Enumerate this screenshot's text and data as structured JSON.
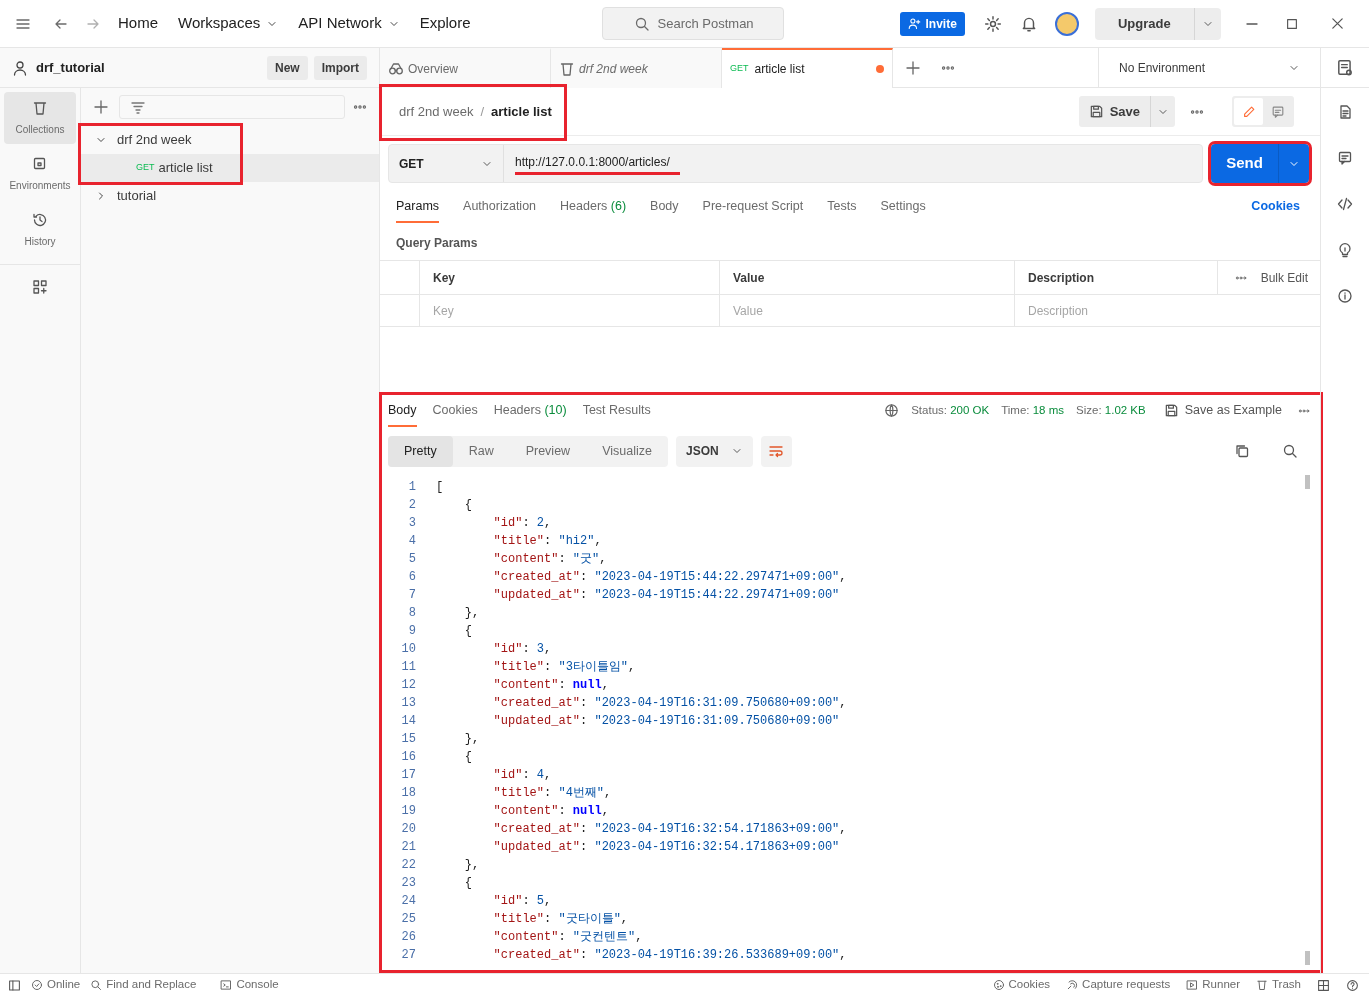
{
  "title_bar": {
    "nav": [
      {
        "label": "Home",
        "dropdown": false
      },
      {
        "label": "Workspaces",
        "dropdown": true
      },
      {
        "label": "API Network",
        "dropdown": true
      },
      {
        "label": "Explore",
        "dropdown": false
      }
    ],
    "search": {
      "placeholder": "Search Postman"
    },
    "invite": "Invite",
    "upgrade": "Upgrade"
  },
  "workspace": {
    "name": "drf_tutorial",
    "buttons": [
      "New",
      "Import"
    ]
  },
  "sidebar": {
    "items": [
      {
        "label": "Collections",
        "kind": "collections",
        "selected": true
      },
      {
        "label": "Environments",
        "kind": "environments",
        "selected": false
      },
      {
        "label": "History",
        "kind": "history",
        "selected": false
      }
    ]
  },
  "collections": [
    {
      "name": "drf 2nd week",
      "expanded": true,
      "children": [
        {
          "method": "GET",
          "name": "article list",
          "selected": true
        }
      ]
    },
    {
      "name": "tutorial",
      "expanded": false
    }
  ],
  "tabs": [
    {
      "kind": "overview",
      "label": "Overview",
      "selected": false,
      "unsaved": false
    },
    {
      "kind": "collection",
      "label": "drf 2nd week",
      "selected": false,
      "unsaved": false
    },
    {
      "kind": "request",
      "method": "GET",
      "label": "article list",
      "selected": true,
      "unsaved": true
    }
  ],
  "environment": "No Environment",
  "breadcrumb": [
    "drf 2nd week",
    "article list"
  ],
  "breadcrumb_separator": "/",
  "modes": [
    {
      "kind": "edit",
      "selected": true
    },
    {
      "kind": "comments",
      "selected": false
    }
  ],
  "save": "Save",
  "request": {
    "method": "GET",
    "url": "http://127.0.0.1:8000/articles/",
    "send": "Send"
  },
  "request_tabs": [
    {
      "label": "Params",
      "selected": true
    },
    {
      "label": "Authorization",
      "selected": false
    },
    {
      "label": "Headers",
      "count": "(6)",
      "selected": false
    },
    {
      "label": "Body",
      "selected": false
    },
    {
      "label": "Pre-request Script",
      "selected": false
    },
    {
      "label": "Tests",
      "selected": false
    },
    {
      "label": "Settings",
      "selected": false
    }
  ],
  "cookies_link": "Cookies",
  "query_params": {
    "title": "Query Params",
    "columns": [
      "Key",
      "Value",
      "Description"
    ],
    "bulk_edit": "Bulk Edit",
    "placeholders": [
      "Key",
      "Value",
      "Description"
    ]
  },
  "response": {
    "tabs": [
      {
        "label": "Body",
        "selected": true
      },
      {
        "label": "Cookies",
        "selected": false
      },
      {
        "label": "Headers",
        "count": "(10)",
        "selected": false
      },
      {
        "label": "Test Results",
        "selected": false
      }
    ],
    "status_label": "Status:",
    "status": "200 OK",
    "time_label": "Time:",
    "time": "18 ms",
    "size_label": "Size:",
    "size": "1.02 KB",
    "save_example": "Save as Example",
    "views": [
      {
        "label": "Pretty",
        "selected": true
      },
      {
        "label": "Raw",
        "selected": false
      },
      {
        "label": "Preview",
        "selected": false
      },
      {
        "label": "Visualize",
        "selected": false
      }
    ],
    "format": "JSON",
    "lines": [
      {
        "number": "1",
        "text": "["
      },
      {
        "number": "2",
        "text": "    {"
      },
      {
        "number": "3",
        "text": "        \"id\": 2,"
      },
      {
        "number": "4",
        "text": "        \"title\": \"hi2\","
      },
      {
        "number": "5",
        "text": "        \"content\": \"굿\","
      },
      {
        "number": "6",
        "text": "        \"created_at\": \"2023-04-19T15:44:22.297471+09:00\","
      },
      {
        "number": "7",
        "text": "        \"updated_at\": \"2023-04-19T15:44:22.297471+09:00\""
      },
      {
        "number": "8",
        "text": "    },"
      },
      {
        "number": "9",
        "text": "    {"
      },
      {
        "number": "10",
        "text": "        \"id\": 3,"
      },
      {
        "number": "11",
        "text": "        \"title\": \"3타이틀임\","
      },
      {
        "number": "12",
        "text": "        \"content\": null,"
      },
      {
        "number": "13",
        "text": "        \"created_at\": \"2023-04-19T16:31:09.750680+09:00\","
      },
      {
        "number": "14",
        "text": "        \"updated_at\": \"2023-04-19T16:31:09.750680+09:00\""
      },
      {
        "number": "15",
        "text": "    },"
      },
      {
        "number": "16",
        "text": "    {"
      },
      {
        "number": "17",
        "text": "        \"id\": 4,"
      },
      {
        "number": "18",
        "text": "        \"title\": \"4번째\","
      },
      {
        "number": "19",
        "text": "        \"content\": null,"
      },
      {
        "number": "20",
        "text": "        \"created_at\": \"2023-04-19T16:32:54.171863+09:00\","
      },
      {
        "number": "21",
        "text": "        \"updated_at\": \"2023-04-19T16:32:54.171863+09:00\""
      },
      {
        "number": "22",
        "text": "    },"
      },
      {
        "number": "23",
        "text": "    {"
      },
      {
        "number": "24",
        "text": "        \"id\": 5,"
      },
      {
        "number": "25",
        "text": "        \"title\": \"굿타이틀\","
      },
      {
        "number": "26",
        "text": "        \"content\": \"굿컨텐트\","
      },
      {
        "number": "27",
        "text": "        \"created_at\": \"2023-04-19T16:39:26.533689+09:00\","
      }
    ]
  },
  "status_bar": {
    "left": [
      {
        "kind": "online",
        "label": "Online"
      },
      {
        "kind": "find",
        "label": "Find and Replace"
      },
      {
        "kind": "console",
        "label": "Console"
      }
    ],
    "right": [
      {
        "kind": "cookies",
        "label": "Cookies"
      },
      {
        "kind": "capture",
        "label": "Capture requests"
      },
      {
        "kind": "runner",
        "label": "Runner"
      },
      {
        "kind": "trash",
        "label": "Trash"
      }
    ]
  }
}
